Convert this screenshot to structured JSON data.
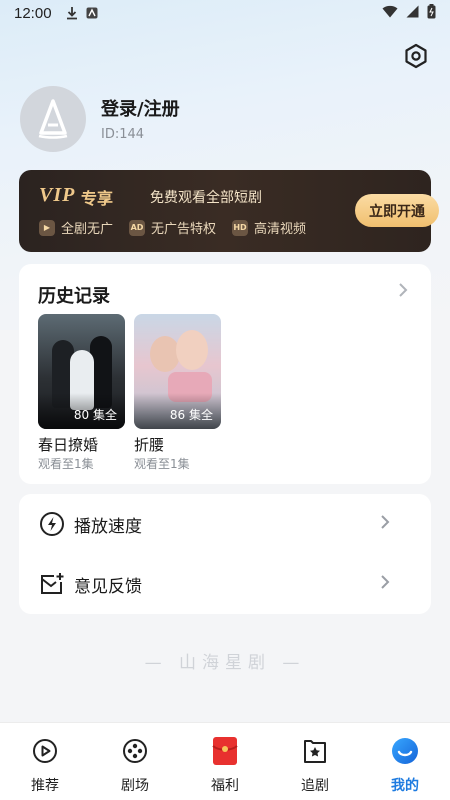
{
  "status_bar": {
    "time": "12:00"
  },
  "profile": {
    "login_label": "登录/注册",
    "user_id": "ID:144"
  },
  "vip": {
    "logo": "VIP",
    "logo_suffix": "专享",
    "description": "免费观看全部短剧",
    "button_label": "立即开通",
    "perks": [
      {
        "icon": "AD",
        "label": "全剧无广"
      },
      {
        "icon": "AD",
        "label": "无广告特权"
      },
      {
        "icon": "HD",
        "label": "高清视频"
      }
    ]
  },
  "history": {
    "title": "历史记录",
    "items": [
      {
        "name": "春日撩婚",
        "episodes": "80 集全",
        "progress": "观看至1集"
      },
      {
        "name": "折腰",
        "episodes": "86 集全",
        "progress": "观看至1集"
      }
    ]
  },
  "settings": {
    "items": [
      {
        "label": "播放速度",
        "icon": "speed-icon"
      },
      {
        "label": "意见反馈",
        "icon": "feedback-icon"
      }
    ]
  },
  "watermark": "— 山海星剧 —",
  "tabs": [
    {
      "label": "推荐",
      "icon": "play-icon",
      "active": false
    },
    {
      "label": "剧场",
      "icon": "film-reel-icon",
      "active": false
    },
    {
      "label": "福利",
      "icon": "red-envelope-icon",
      "active": false
    },
    {
      "label": "追剧",
      "icon": "bookmark-star-icon",
      "active": false
    },
    {
      "label": "我的",
      "icon": "profile-icon",
      "active": true
    }
  ],
  "colors": {
    "accent": "#1e7be0",
    "vip_gold": "#f0c98b",
    "vip_background": "#2b2320",
    "red_envelope": "#e8312f"
  }
}
